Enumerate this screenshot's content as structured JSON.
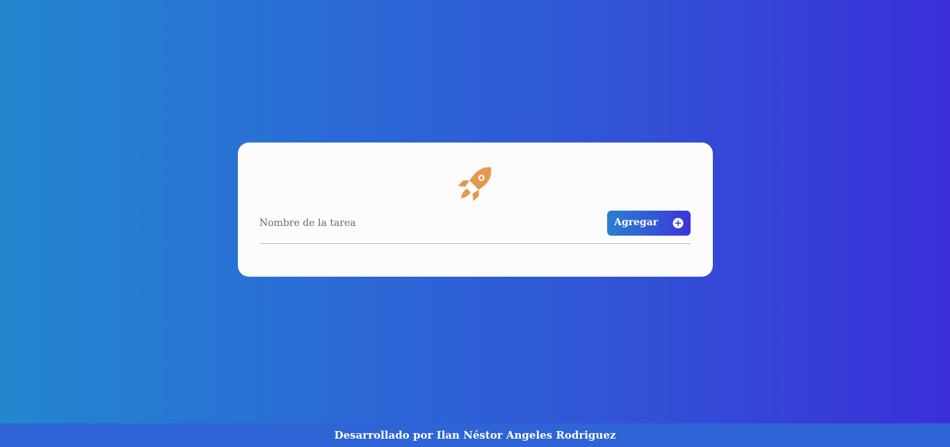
{
  "card": {
    "logo_icon": "rocket-icon",
    "logo_color": "#e39a4c"
  },
  "task_form": {
    "input_value": "",
    "input_placeholder": "Nombre de la tarea",
    "add_button_label": "Agregar",
    "add_button_icon": "plus-circle-icon"
  },
  "footer": {
    "text": "Desarrollado por Ilan Néstor Angeles Rodriguez"
  },
  "colors": {
    "background_start": "#2387cf",
    "background_end": "#3a2fd9",
    "card": "#fcfcfc",
    "accent": "#3455d6"
  }
}
